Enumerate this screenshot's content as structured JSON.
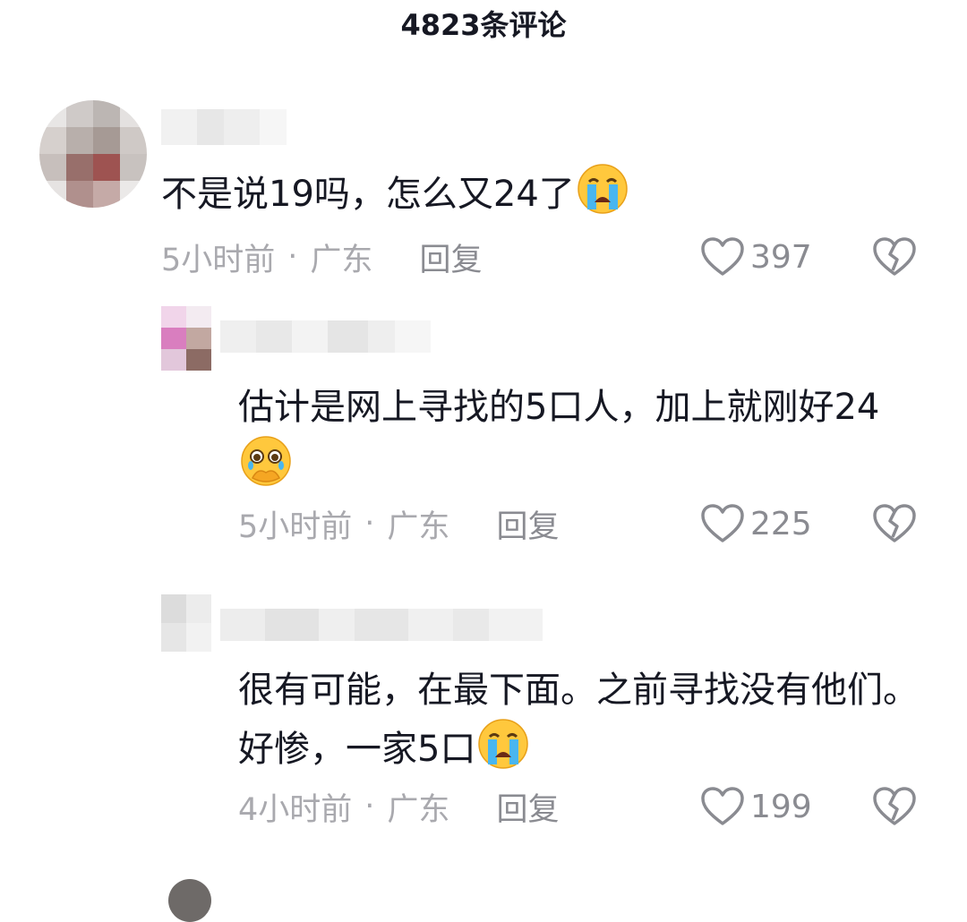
{
  "header": {
    "title": "4823条评论"
  },
  "comments": [
    {
      "text": "不是说19吗，怎么又24了",
      "emoji": "loudly-crying-face",
      "time": "5小时前",
      "location": "广东",
      "reply_label": "回复",
      "likes": "397"
    },
    {
      "text": "估计是网上寻找的5口人，加上就刚好24",
      "emoji": "face-holding-back-tears",
      "time": "5小时前",
      "location": "广东",
      "reply_label": "回复",
      "likes": "225"
    },
    {
      "text": "很有可能，在最下面。之前寻找没有他们。好惨，一家5口",
      "emoji": "loudly-crying-face",
      "time": "4小时前",
      "location": "广东",
      "reply_label": "回复",
      "likes": "199"
    }
  ],
  "meta_separator": "·",
  "colors": {
    "text_primary": "#161823",
    "text_meta": "#a9a9ae",
    "text_action": "#8a8b91",
    "emoji_yellow": "#ffc83d",
    "emoji_tear": "#49b6f0"
  },
  "icons": {
    "like": "heart-outline-icon",
    "dislike": "broken-heart-icon"
  }
}
